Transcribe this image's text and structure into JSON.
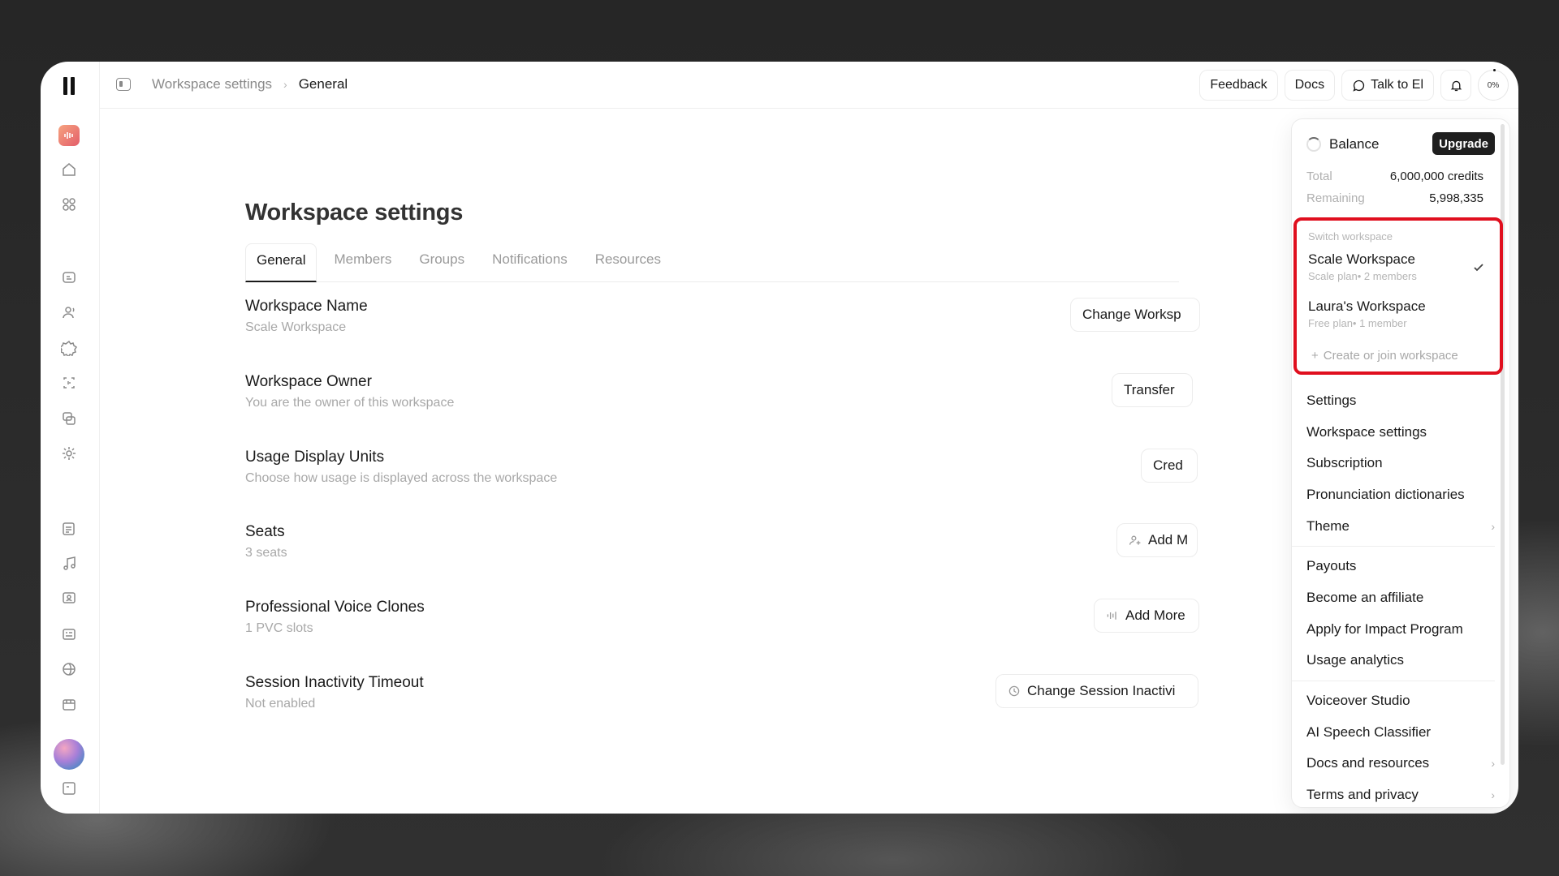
{
  "topbar": {
    "breadcrumb_parent": "Workspace settings",
    "breadcrumb_sep": "›",
    "breadcrumb_current": "General",
    "feedback": "Feedback",
    "docs": "Docs",
    "talk": "Talk to El",
    "usage_percent": "0%"
  },
  "page": {
    "title": "Workspace settings",
    "tabs": [
      "General",
      "Members",
      "Groups",
      "Notifications",
      "Resources"
    ],
    "rows": [
      {
        "title": "Workspace Name",
        "sub": "Scale Workspace",
        "button": "Change Worksp"
      },
      {
        "title": "Workspace Owner",
        "sub": "You are the owner of this workspace",
        "button": "Transfer"
      },
      {
        "title": "Usage Display Units",
        "sub": "Choose how usage is displayed across the workspace",
        "button": "Cred"
      },
      {
        "title": "Seats",
        "sub": "3 seats",
        "button": "Add M"
      },
      {
        "title": "Professional Voice Clones",
        "sub": "1 PVC slots",
        "button": "Add More"
      },
      {
        "title": "Session Inactivity Timeout",
        "sub": "Not enabled",
        "button": "Change Session Inactivi"
      }
    ]
  },
  "dropdown": {
    "balance_label": "Balance",
    "upgrade": "Upgrade",
    "total_label": "Total",
    "total_value": "6,000,000 credits",
    "remaining_label": "Remaining",
    "remaining_value": "5,998,335",
    "switch_label": "Switch workspace",
    "workspaces": [
      {
        "name": "Scale Workspace",
        "meta": "Scale plan• 2 members"
      },
      {
        "name": "Laura's Workspace",
        "meta": "Free plan• 1 member"
      }
    ],
    "create_ws": "Create or join workspace",
    "menu_group1": [
      "Settings",
      "Workspace settings",
      "Subscription",
      "Pronunciation dictionaries",
      "Theme"
    ],
    "menu_group2": [
      "Payouts",
      "Become an affiliate",
      "Apply for Impact Program",
      "Usage analytics"
    ],
    "menu_group3": [
      "Voiceover Studio",
      "AI Speech Classifier",
      "Docs and resources",
      "Terms and privacy"
    ]
  },
  "colors": {
    "highlight": "#e00f1e",
    "accent_gradient_start": "#f6a37f",
    "accent_gradient_end": "#e35d6a"
  }
}
